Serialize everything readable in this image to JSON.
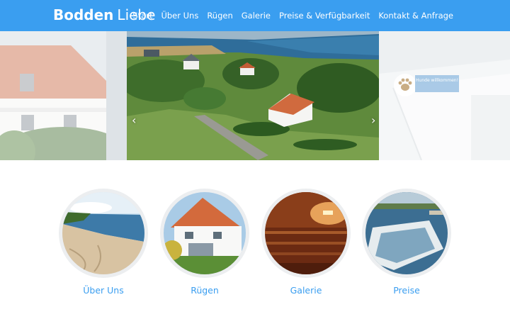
{
  "brand": {
    "name_bold": "Bodden",
    "name_light": "Liebe"
  },
  "nav": {
    "items": [
      "Start",
      "Über Uns",
      "Rügen",
      "Galerie",
      "Preise & Verfügbarkeit",
      "Kontakt & Anfrage"
    ]
  },
  "slider": {
    "prev_icon": "chevron-left-icon",
    "next_icon": "chevron-right-icon",
    "badge": {
      "icon": "paw-icon",
      "text": "Hunde willkommen!"
    }
  },
  "cards": [
    {
      "label": "Über Uns",
      "image": "beach-photo"
    },
    {
      "label": "Rügen",
      "image": "house-photo"
    },
    {
      "label": "Galerie",
      "image": "sauna-photo"
    },
    {
      "label": "Preise",
      "image": "boat-photo"
    }
  ],
  "colors": {
    "accent": "#3a9ef0",
    "header_bg": "#3a9ef0",
    "background": "#ffffff"
  }
}
